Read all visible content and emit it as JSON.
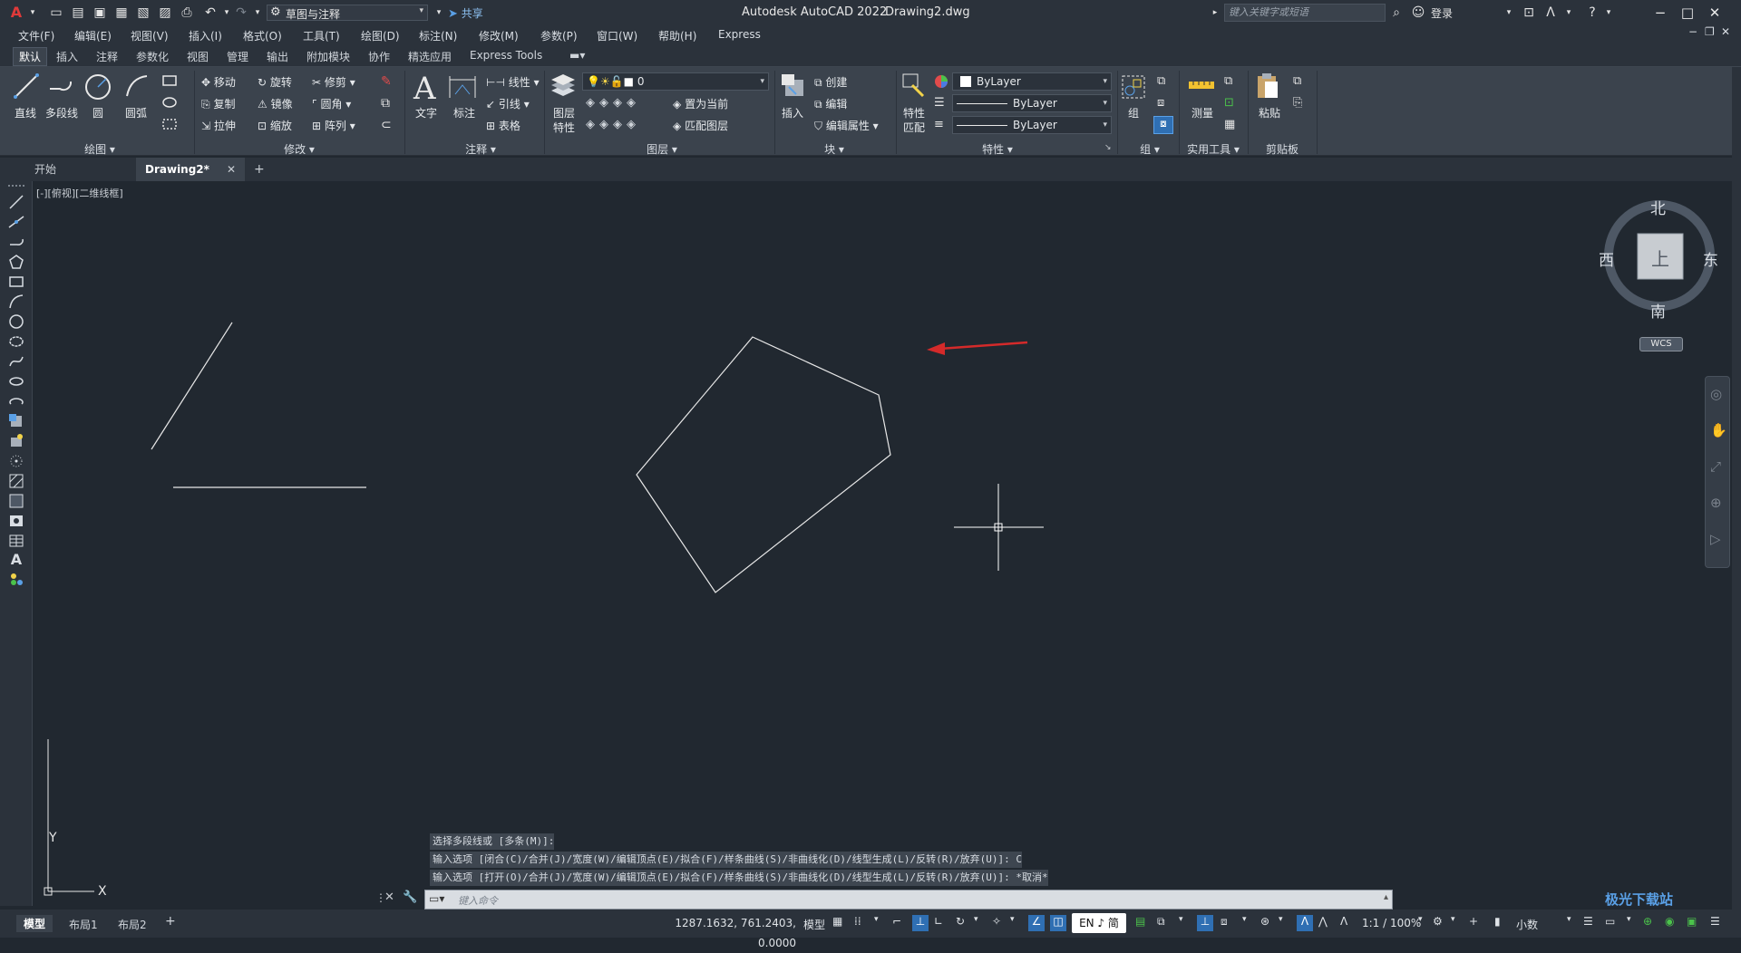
{
  "app": {
    "title": "Autodesk AutoCAD 2022",
    "document": "Drawing2.dwg",
    "workspace": "草图与注释",
    "share_label": "共享",
    "search_placeholder": "键入关键字或短语",
    "login_label": "登录"
  },
  "menu": [
    "文件(F)",
    "编辑(E)",
    "视图(V)",
    "插入(I)",
    "格式(O)",
    "工具(T)",
    "绘图(D)",
    "标注(N)",
    "修改(M)",
    "参数(P)",
    "窗口(W)",
    "帮助(H)",
    "Express"
  ],
  "ribbon_tabs": [
    "默认",
    "插入",
    "注释",
    "参数化",
    "视图",
    "管理",
    "输出",
    "附加模块",
    "协作",
    "精选应用",
    "Express Tools"
  ],
  "ribbon": {
    "draw": {
      "title": "绘图",
      "line": "直线",
      "polyline": "多段线",
      "circle": "圆",
      "arc": "圆弧"
    },
    "modify": {
      "title": "修改",
      "move": "移动",
      "rotate": "旋转",
      "trim": "修剪",
      "copy": "复制",
      "mirror": "镜像",
      "fillet": "圆角",
      "stretch": "拉伸",
      "scale": "缩放",
      "array": "阵列"
    },
    "annotation": {
      "title": "注释",
      "text": "文字",
      "dimension": "标注",
      "linear": "线性",
      "leader": "引线",
      "table": "表格"
    },
    "layers": {
      "title": "图层",
      "layer_props_1": "图层",
      "layer_props_2": "特性",
      "current_layer": "0",
      "set_current": "置为当前",
      "match_layer": "匹配图层"
    },
    "block": {
      "title": "块",
      "insert": "插入",
      "create": "创建",
      "edit": "编辑",
      "edit_attr": "编辑属性"
    },
    "properties": {
      "title": "特性",
      "match_1": "特性",
      "match_2": "匹配",
      "color": "ByLayer",
      "linetype": "ByLayer",
      "lineweight": "ByLayer"
    },
    "groups": {
      "title": "组",
      "group": "组"
    },
    "utilities": {
      "title": "实用工具",
      "measure": "测量"
    },
    "clipboard": {
      "title": "剪贴板",
      "paste": "粘贴"
    }
  },
  "file_tabs": {
    "start": "开始",
    "drawing": "Drawing2*"
  },
  "viewport_label": "[-][俯视][二维线框]",
  "viewcube": {
    "north": "北",
    "south": "南",
    "east": "东",
    "west": "西",
    "face": "上",
    "wcs": "WCS"
  },
  "ucs": {
    "x": "X",
    "y": "Y"
  },
  "command_history": [
    "选择多段线或 [多条(M)]:",
    "输入选项 [闭合(C)/合并(J)/宽度(W)/编辑顶点(E)/拟合(F)/样条曲线(S)/非曲线化(D)/线型生成(L)/反转(R)/放弃(U)]: C",
    "输入选项 [打开(O)/合并(J)/宽度(W)/编辑顶点(E)/拟合(F)/样条曲线(S)/非曲线化(D)/线型生成(L)/反转(R)/放弃(U)]: *取消*"
  ],
  "command_placeholder": "键入命令",
  "layout_tabs": [
    "模型",
    "布局1",
    "布局2"
  ],
  "status": {
    "coordinates": "1287.1632, 761.2403, 0.0000",
    "model": "模型",
    "ime": "EN ♪ 简",
    "scale": "1:1 / 100%",
    "units": "小数"
  },
  "watermark": "极光下载站",
  "colors": {
    "accent_red": "#d42a2a",
    "canvas": "#212830",
    "panel": "#3b434d"
  }
}
